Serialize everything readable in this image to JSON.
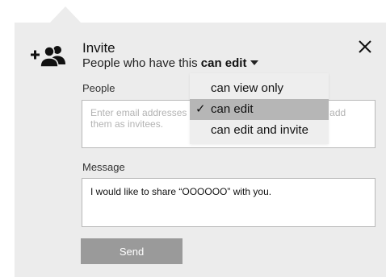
{
  "dialog": {
    "title": "Invite",
    "subtitle_prefix": "People who have this",
    "current_permission": "can edit",
    "close_icon": "close-icon",
    "add_user_icon": "add-user-icon"
  },
  "people": {
    "label": "People",
    "placeholder": "Enter email addresses or names of people or groups to add them as invitees.",
    "value": ""
  },
  "message": {
    "label": "Message",
    "value": "I would like to share “OOOOOO” with you."
  },
  "send_button": {
    "label": "Send"
  },
  "permission_dropdown": {
    "items": [
      {
        "label": "can view only",
        "selected": false
      },
      {
        "label": "can edit",
        "selected": true
      },
      {
        "label": "can edit and invite",
        "selected": false
      }
    ],
    "check_icon": "check-icon"
  },
  "colors": {
    "panel_background": "#ececec",
    "selected_item": "#b6b6b6",
    "send_button": "#9a9a9a"
  }
}
